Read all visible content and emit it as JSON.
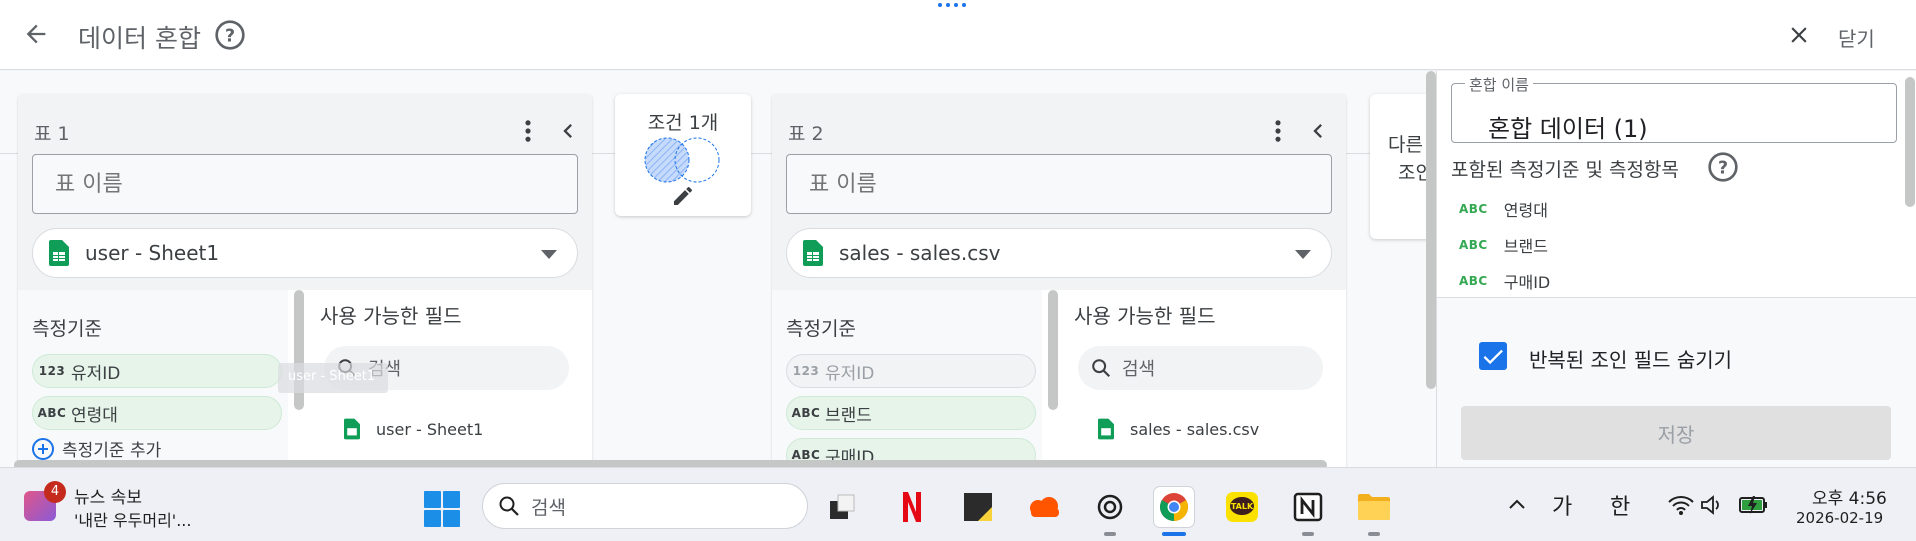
{
  "header": {
    "title": "데이터 혼합",
    "close_label": "닫기"
  },
  "tables": [
    {
      "title": "표 1",
      "name_placeholder": "표 이름",
      "source": "user - Sheet1",
      "dimensions_title": "측정기준",
      "dimensions": [
        {
          "type": "123",
          "label": "유저ID"
        },
        {
          "type": "ABC",
          "label": "연령대"
        }
      ],
      "add_dimension": "측정기준 추가",
      "fields_title": "사용 가능한 필드",
      "search_placeholder": "검색",
      "field_source": "user - Sheet1"
    },
    {
      "title": "표 2",
      "name_placeholder": "표 이름",
      "source": "sales - sales.csv",
      "dimensions_title": "측정기준",
      "dimensions": [
        {
          "type": "123",
          "label": "유저ID"
        },
        {
          "type": "ABC",
          "label": "브랜드"
        },
        {
          "type": "ABC",
          "label": "구매ID"
        }
      ],
      "fields_title": "사용 가능한 필드",
      "search_placeholder": "검색",
      "field_source": "sales - sales.csv"
    }
  ],
  "drag_ghost": "user - Sheet1",
  "condition": {
    "label": "조건 1개"
  },
  "add_table": {
    "line1": "다른",
    "line2": "조인"
  },
  "right_panel": {
    "blend_name_label": "혼합 이름",
    "blend_name_value": "혼합 데이터 (1)",
    "included_title": "포함된 측정기준 및 측정항목",
    "included_items": [
      {
        "type": "ABC",
        "label": "연령대"
      },
      {
        "type": "ABC",
        "label": "브랜드"
      },
      {
        "type": "ABC",
        "label": "구매ID"
      }
    ],
    "hide_repeated_label": "반복된 조인 필드 숨기기",
    "hide_repeated_checked": true,
    "save_label": "저장"
  },
  "taskbar": {
    "news_badge": "4",
    "news_title": "뉴스 속보",
    "news_subtitle": "'내란 우두머리'...",
    "search_placeholder": "검색",
    "tray_ime_1": "가",
    "tray_ime_2": "한",
    "time": "오후 4:56",
    "date": "2026-02-19"
  },
  "colors": {
    "accent": "#1a73e8",
    "chip_bg": "#e6f4ea",
    "sheet_green": "#0f9d58"
  }
}
